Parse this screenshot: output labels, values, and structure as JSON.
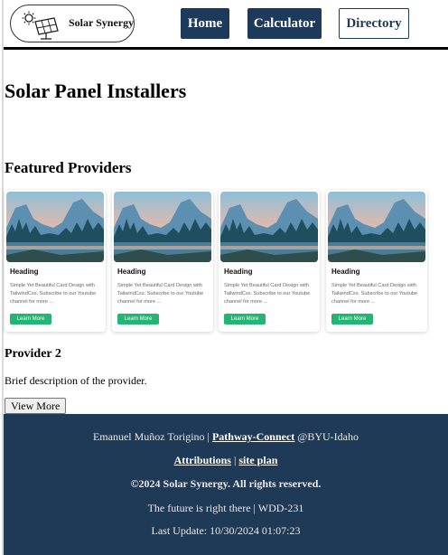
{
  "header": {
    "brand": "Solar Synergy",
    "logo_icon": "solar-panel-logo-icon",
    "nav": [
      {
        "label": "Home"
      },
      {
        "label": "Calculator"
      },
      {
        "label": "Directory"
      }
    ]
  },
  "main": {
    "title": "Solar Panel Installers",
    "featured_title": "Featured Providers",
    "cards": [
      {
        "heading": "Heading",
        "text": "Simple Yet Beautiful Card Design with TailwindCss. Subscribe to our Youtube channel for more ...",
        "button": "Learn More"
      },
      {
        "heading": "Heading",
        "text": "Simple Yet Beautiful Card Design with TailwindCss. Subscribe to our Youtube channel for more ...",
        "button": "Learn More"
      },
      {
        "heading": "Heading",
        "text": "Simple Yet Beautiful Card Design with TailwindCss. Subscribe to our Youtube channel for more ...",
        "button": "Learn More"
      },
      {
        "heading": "Heading",
        "text": "Simple Yet Beautiful Card Design with TailwindCss. Subscribe to our Youtube channel for more ...",
        "button": "Learn More"
      }
    ],
    "provider": {
      "name": "Provider 2",
      "description": "Brief description of the provider.",
      "button": "View More"
    }
  },
  "footer": {
    "author": "Emanuel Muñoz Torigino |",
    "link_pathway": "Pathway-Connect",
    "school": "@BYU-Idaho",
    "link_attributions": "Attributions",
    "separator": "|",
    "link_siteplan": "site plan",
    "copyright": "©2024 Solar Synergy. All rights reserved.",
    "tagline": "The future is right there | WDD-231",
    "last_update": "Last Update: 10/30/2024 01:07:23"
  },
  "colors": {
    "navy": "#1e3a5a",
    "footer_bg": "#1f3a57",
    "card_button": "#22b573"
  }
}
